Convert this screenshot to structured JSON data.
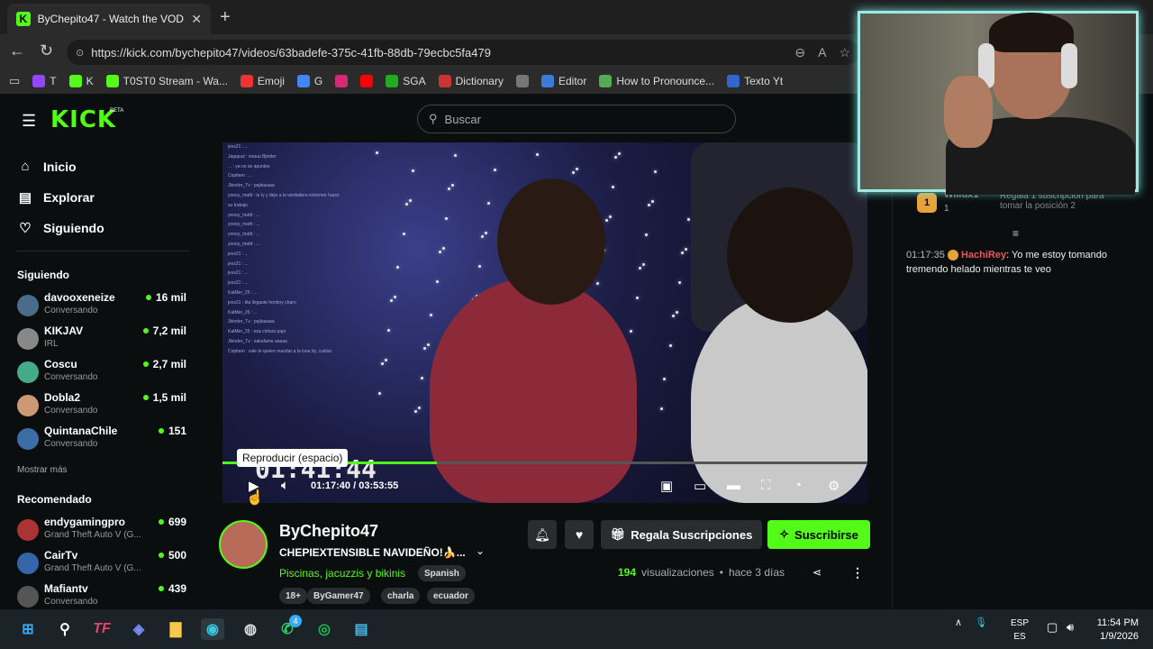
{
  "browser": {
    "tab_title": "ByChepito47 - Watch the VOD on",
    "url": "https://kick.com/bychepito47/videos/63badefe-375c-41fb-88db-79ecbc5fa479",
    "bookmarks": [
      {
        "label": "T",
        "color": "#9146ff",
        "icon": "twitch-icon"
      },
      {
        "label": "K",
        "color": "#53fc18",
        "icon": "kick-icon"
      },
      {
        "label": "T0ST0 Stream - Wa...",
        "color": "#53fc18",
        "icon": "kick-icon"
      },
      {
        "label": "Emoji",
        "color": "#e33",
        "icon": "bolt-icon"
      },
      {
        "label": "G",
        "color": "#4285f4",
        "icon": "google-icon"
      },
      {
        "label": "",
        "color": "#d62976",
        "icon": "instagram-icon"
      },
      {
        "label": "",
        "color": "#ff0000",
        "icon": "youtube-icon"
      },
      {
        "label": "SGA",
        "color": "#2a2",
        "icon": "sga-icon"
      },
      {
        "label": "Dictionary",
        "color": "#c33",
        "icon": "dictionary-icon"
      },
      {
        "label": "",
        "color": "#777",
        "icon": "openai-icon"
      },
      {
        "label": "Editor",
        "color": "#3b7bd8",
        "icon": "editor-icon"
      },
      {
        "label": "How to Pronounce...",
        "color": "#5a5",
        "icon": "pronounce-icon"
      },
      {
        "label": "Texto Yt",
        "color": "#36c",
        "icon": "doc-icon"
      }
    ]
  },
  "kick": {
    "logo": "KICK",
    "beta": "BETA",
    "search_placeholder": "Buscar",
    "nav": {
      "home": "Inicio",
      "explore": "Explorar",
      "following": "Siguiendo"
    },
    "following_header": "Siguiendo",
    "following": [
      {
        "name": "davooxeneize",
        "category": "Conversando",
        "viewers": "16 mil",
        "color": "#4a6b8a"
      },
      {
        "name": "KIKJAV",
        "category": "IRL",
        "viewers": "7,2 mil",
        "color": "#888"
      },
      {
        "name": "Coscu",
        "category": "Conversando",
        "viewers": "2,7 mil",
        "color": "#4a8"
      },
      {
        "name": "Dobla2",
        "category": "Conversando",
        "viewers": "1,5 mil",
        "color": "#c97"
      },
      {
        "name": "QuintanaChile",
        "category": "Conversando",
        "viewers": "151",
        "color": "#3a6ea5"
      }
    ],
    "show_more": "Mostrar más",
    "recommended_header": "Recomendado",
    "recommended": [
      {
        "name": "endygamingpro",
        "category": "Grand Theft Auto V (G...",
        "viewers": "699",
        "color": "#a33"
      },
      {
        "name": "CairTv",
        "category": "Grand Theft Auto V (G...",
        "viewers": "500",
        "color": "#36a"
      },
      {
        "name": "Mafiantv",
        "category": "Conversando",
        "viewers": "439",
        "color": "#555"
      }
    ]
  },
  "player": {
    "tooltip": "Reproducir (espacio)",
    "overlay_time": "01:41:44",
    "current": "01:17:40",
    "duration": "03:53:55",
    "progress": 0.332
  },
  "video_chat_overlay": [
    "jexx21 : ...",
    "Jagajuul : nouuu Bjinder",
    "... : ya no se apuntes",
    "Copitam : ...",
    "Jbinder_Tv : pajitasaaa",
    "yoooy_mattt : la ty y dejo a la verdadera extremer hacer",
    "su trabajo",
    "yoooy_mattt : ...",
    "yoooy_mattt : ...",
    "yoooy_mattt : ...",
    "yoooy_mattt : ...",
    "jexx21 : ...",
    "jexx21 : ...",
    "jexx21 : ...",
    "jexx21 : ...",
    "KatMer_25 : ...",
    "jexx21 : tita llegaste femboy charo",
    "KatMer_25 : ...",
    "Jbinder_Tv : pajitasaaa",
    "KatMer_25 : esa cintura papi",
    "Jbinder_Tv : saludame aaaaa",
    "Copitam : vale te quiere mandar a la luna by, cuidao"
  ],
  "info": {
    "channel": "ByChepito47",
    "stream_title": "CHEPIEXTENSIBLE NAVIDEÑO!🍌...",
    "category": "Piscinas, jacuzzis y bikinis",
    "language": "Spanish",
    "tags": [
      "18+",
      "ByGamer47",
      "charla",
      "ecuador"
    ],
    "gift_label": "Regala Suscripciones",
    "subscribe_label": "Suscribirse",
    "views_count": "194",
    "views_label": "visualizaciones",
    "ago": "hace 3 días"
  },
  "chat": {
    "pinned_user": "Willux1",
    "pinned_count": "1",
    "pinned_text": "Regala 1 suscripción para tomar la posición 2",
    "message": {
      "time": "01:17:35",
      "user": "HachiRey",
      "text": "Yo me estoy tomando tremendo helado mientras te veo"
    }
  },
  "taskbar": {
    "lang_top": "ESP",
    "lang_bottom": "ES",
    "time": "11:54 PM",
    "date": "1/9/2026",
    "whatsapp_badge": "4"
  }
}
